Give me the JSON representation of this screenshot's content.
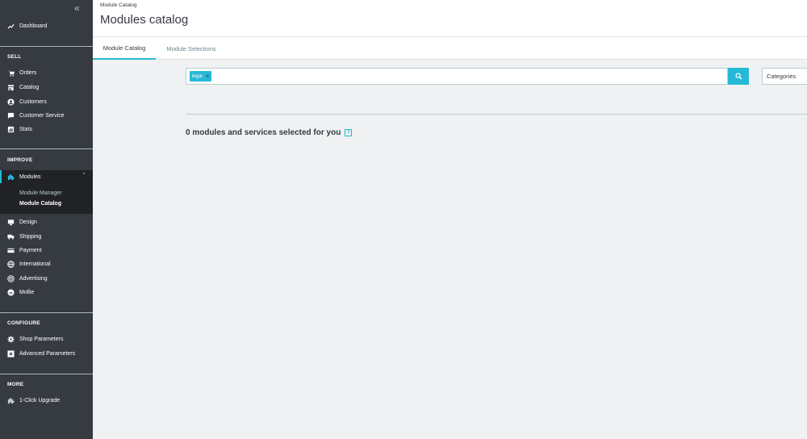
{
  "sidebar": {
    "collapse_icon": "double-chevron-left-icon",
    "dashboard": {
      "label": "Dashboard",
      "icon": "trending-up-icon"
    },
    "sections": {
      "sell": "SELL",
      "improve": "IMPROVE",
      "configure": "CONFIGURE",
      "more": "MORE"
    },
    "sell_items": [
      {
        "label": "Orders",
        "icon": "cart-icon"
      },
      {
        "label": "Catalog",
        "icon": "store-icon"
      },
      {
        "label": "Customers",
        "icon": "user-icon"
      },
      {
        "label": "Customer Service",
        "icon": "chat-icon"
      },
      {
        "label": "Stats",
        "icon": "bar-chart-icon"
      }
    ],
    "modules": {
      "label": "Modules",
      "icon": "puzzle-icon"
    },
    "modules_sub": [
      {
        "label": "Module Manager"
      },
      {
        "label": "Module Catalog"
      }
    ],
    "improve_items": [
      {
        "label": "Design",
        "icon": "monitor-icon"
      },
      {
        "label": "Shipping",
        "icon": "truck-icon"
      },
      {
        "label": "Payment",
        "icon": "credit-card-icon"
      },
      {
        "label": "International",
        "icon": "globe-icon"
      },
      {
        "label": "Advertising",
        "icon": "target-icon"
      },
      {
        "label": "Mollie",
        "icon": "mollie-icon"
      }
    ],
    "configure_items": [
      {
        "label": "Shop Parameters",
        "icon": "gear-icon"
      },
      {
        "label": "Advanced Parameters",
        "icon": "settings-box-icon"
      }
    ],
    "more_items": [
      {
        "label": "1-Click Upgrade",
        "icon": "puzzle-icon"
      }
    ]
  },
  "header": {
    "breadcrumb": "Module Catalog",
    "title": "Modules catalog"
  },
  "tabs": [
    {
      "label": "Module Catalog",
      "active": true
    },
    {
      "label": "Module Selections",
      "active": false
    }
  ],
  "search": {
    "tag": "legal",
    "tag_close": "×",
    "button_icon": "search-icon"
  },
  "categories": {
    "label": "Categories"
  },
  "selection": {
    "heading": "0 modules and services selected for you",
    "help": "?"
  },
  "colors": {
    "accent": "#25b9d7",
    "sidebar": "#363a41",
    "sidebar_active": "#202226"
  }
}
